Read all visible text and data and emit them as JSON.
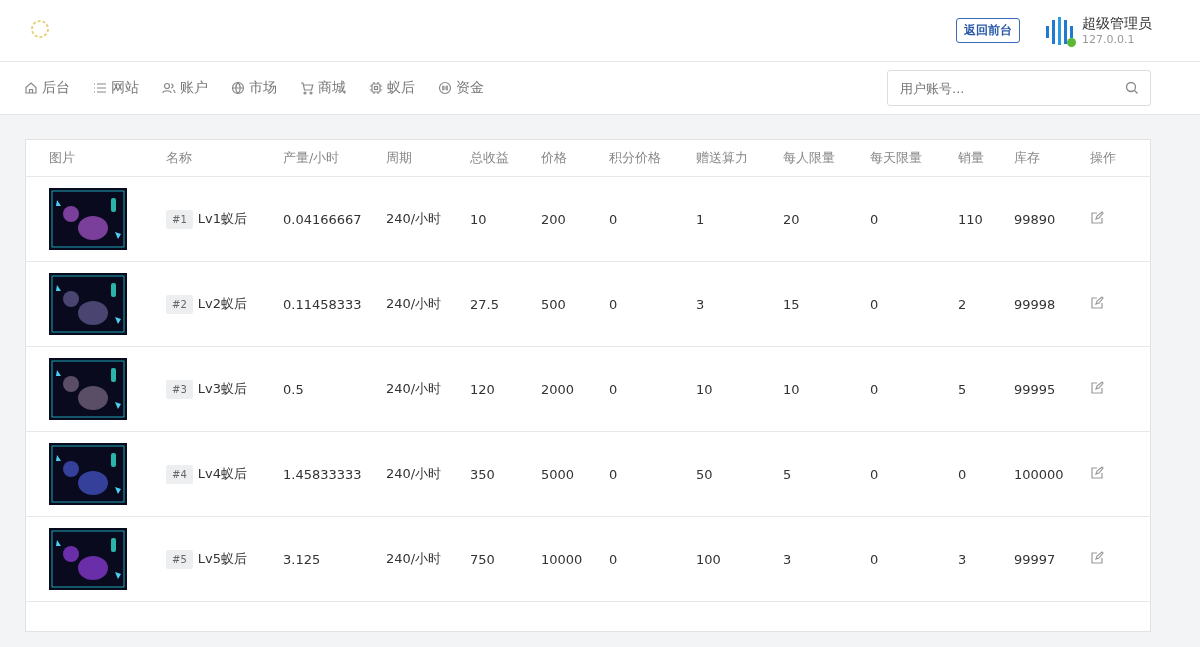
{
  "header": {
    "return_button": "返回前台",
    "user": {
      "name": "超级管理员",
      "ip": "127.0.0.1",
      "online": true
    }
  },
  "nav": [
    {
      "label": "后台"
    },
    {
      "label": "网站"
    },
    {
      "label": "账户"
    },
    {
      "label": "市场"
    },
    {
      "label": "商城"
    },
    {
      "label": "蚁后"
    },
    {
      "label": "资金"
    }
  ],
  "search": {
    "placeholder": "用户账号..."
  },
  "table": {
    "columns": [
      "图片",
      "名称",
      "产量/小时",
      "周期",
      "总收益",
      "价格",
      "积分价格",
      "赠送算力",
      "每人限量",
      "每天限量",
      "销量",
      "库存",
      "操作"
    ],
    "rows": [
      {
        "id": "#1",
        "name": "Lv1蚁后",
        "output": "0.04166667",
        "period": "240/小时",
        "total_income": "10",
        "price": "200",
        "points_price": "0",
        "bonus_power": "1",
        "limit_per_person": "20",
        "limit_per_day": "0",
        "sales": "110",
        "stock": "99890"
      },
      {
        "id": "#2",
        "name": "Lv2蚁后",
        "output": "0.11458333",
        "period": "240/小时",
        "total_income": "27.5",
        "price": "500",
        "points_price": "0",
        "bonus_power": "3",
        "limit_per_person": "15",
        "limit_per_day": "0",
        "sales": "2",
        "stock": "99998"
      },
      {
        "id": "#3",
        "name": "Lv3蚁后",
        "output": "0.5",
        "period": "240/小时",
        "total_income": "120",
        "price": "2000",
        "points_price": "0",
        "bonus_power": "10",
        "limit_per_person": "10",
        "limit_per_day": "0",
        "sales": "5",
        "stock": "99995"
      },
      {
        "id": "#4",
        "name": "Lv4蚁后",
        "output": "1.45833333",
        "period": "240/小时",
        "total_income": "350",
        "price": "5000",
        "points_price": "0",
        "bonus_power": "50",
        "limit_per_person": "5",
        "limit_per_day": "0",
        "sales": "0",
        "stock": "100000"
      },
      {
        "id": "#5",
        "name": "Lv5蚁后",
        "output": "3.125",
        "period": "240/小时",
        "total_income": "750",
        "price": "10000",
        "points_price": "0",
        "bonus_power": "100",
        "limit_per_person": "3",
        "limit_per_day": "0",
        "sales": "3",
        "stock": "99997"
      }
    ]
  }
}
